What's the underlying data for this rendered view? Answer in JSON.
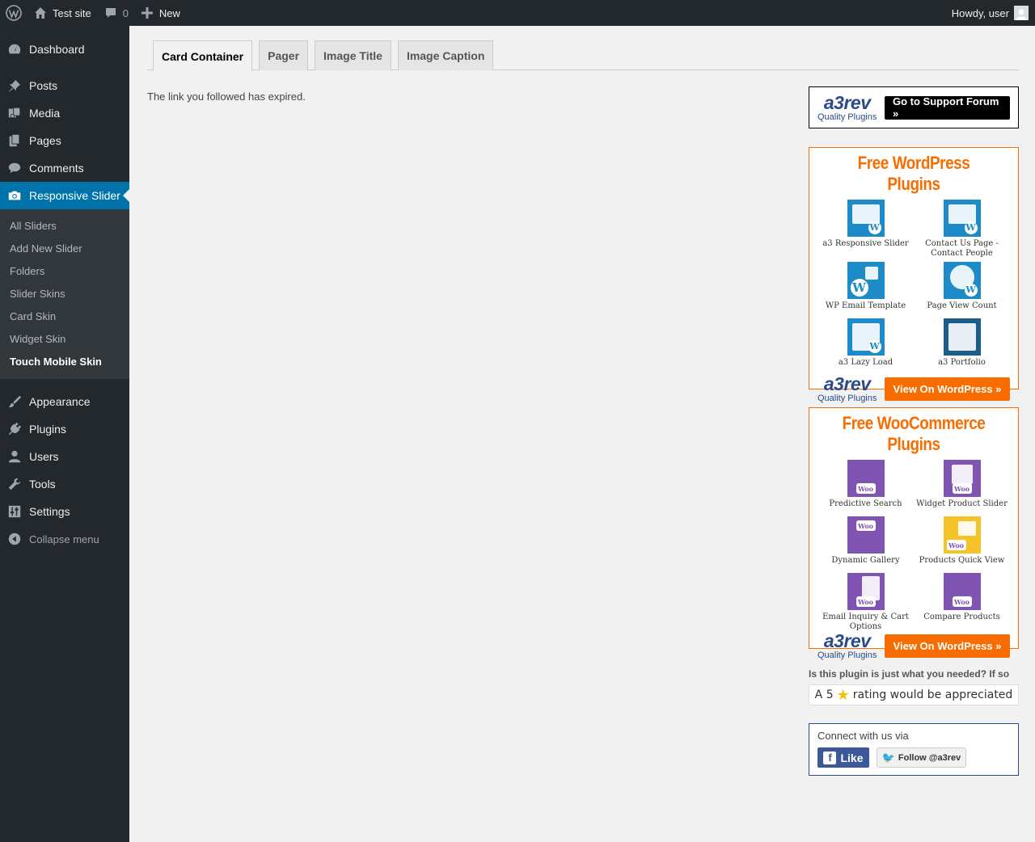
{
  "adminbar": {
    "site_name": "Test site",
    "comments_count": "0",
    "new_label": "New",
    "howdy": "Howdy, user"
  },
  "sidebar": {
    "items_top": [
      {
        "label": "Dashboard",
        "icon": "dashboard-icon"
      }
    ],
    "items": [
      {
        "label": "Posts",
        "icon": "pin-icon"
      },
      {
        "label": "Media",
        "icon": "media-icon"
      },
      {
        "label": "Pages",
        "icon": "pages-icon"
      },
      {
        "label": "Comments",
        "icon": "comment-icon"
      },
      {
        "label": "Responsive Slider",
        "icon": "camera-icon"
      }
    ],
    "submenu": [
      "All Sliders",
      "Add New Slider",
      "Folders",
      "Slider Skins",
      "Card Skin",
      "Widget Skin",
      "Touch Mobile Skin"
    ],
    "items_bottom": [
      {
        "label": "Appearance",
        "icon": "brush-icon"
      },
      {
        "label": "Plugins",
        "icon": "plug-icon"
      },
      {
        "label": "Users",
        "icon": "user-icon"
      },
      {
        "label": "Tools",
        "icon": "wrench-icon"
      },
      {
        "label": "Settings",
        "icon": "sliders-icon"
      }
    ],
    "collapse_label": "Collapse menu"
  },
  "tabs": [
    "Card Container",
    "Pager",
    "Image Title",
    "Image Caption"
  ],
  "message": "The link you followed has expired.",
  "support": {
    "logo_big": "a3rev",
    "logo_small": "Quality Plugins",
    "button": "Go to Support Forum »"
  },
  "wp_plugins": {
    "title": "Free WordPress Plugins",
    "items": [
      "a3 Responsive Slider",
      "Contact Us Page - Contact People",
      "WP Email Template",
      "Page View Count",
      "a3 Lazy Load",
      "a3 Portfolio"
    ],
    "button": "View On WordPress »"
  },
  "woo_plugins": {
    "title": "Free WooCommerce Plugins",
    "items": [
      "Predictive Search",
      "Widget Product Slider",
      "Dynamic Gallery",
      "Products Quick View",
      "Email Inquiry & Cart Options",
      "Compare Products"
    ],
    "button": "View On WordPress »"
  },
  "rating": {
    "question": "Is this plugin is just what you needed? If so",
    "prefix": "A 5",
    "suffix": "rating would be appreciated"
  },
  "connect": {
    "label": "Connect with us via",
    "facebook": "Like",
    "twitter": "Follow @a3rev"
  },
  "colors": {
    "adminbar": "#23282d",
    "active_menu": "#0073aa",
    "orange": "#f96d00",
    "a3_blue": "#2a4a8a"
  }
}
